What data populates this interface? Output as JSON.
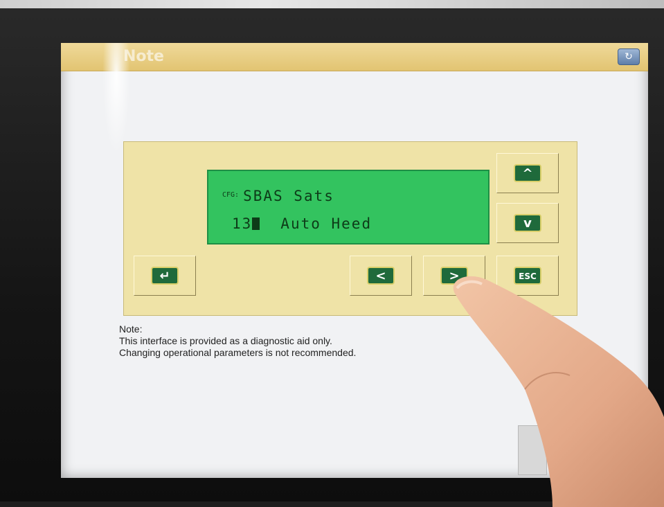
{
  "window": {
    "title": "Note",
    "title_button_icon": "refresh-icon"
  },
  "lcd": {
    "line1_prefix": "CFG:",
    "line1_text": "SBAS Sats",
    "line2_value": "13",
    "line2_text": "Auto Heed"
  },
  "keys": {
    "up": "^",
    "down": "v",
    "enter": "↵",
    "left": "<",
    "right": ">",
    "esc": "ESC"
  },
  "note": {
    "heading": "Note:",
    "line1": "This interface is provided as a diagnostic aid only.",
    "line2": "Changing operational parameters is not recommended."
  },
  "colors": {
    "lcd_background": "#33c35f",
    "panel_background": "#efe3a7",
    "key_face": "#1f6a3b",
    "titlebar": "#e2c472"
  }
}
